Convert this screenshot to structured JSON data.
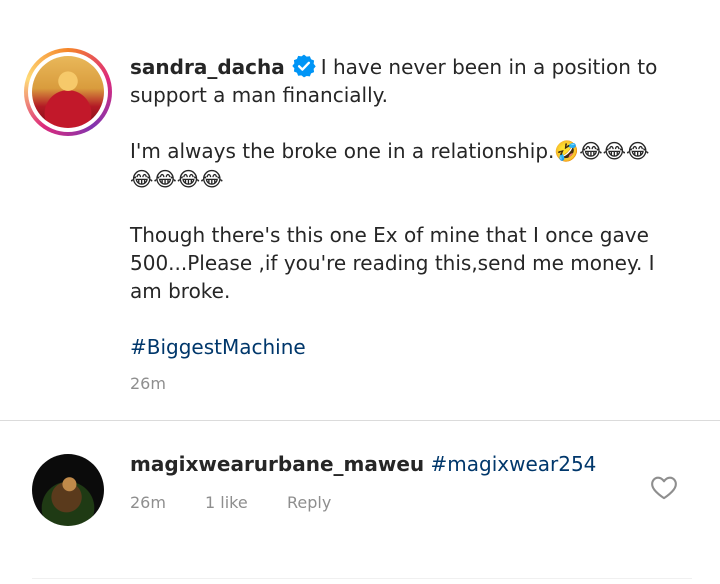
{
  "post": {
    "username": "sandra_dacha",
    "caption_line1": "I have never been in a position to support a man financially.",
    "caption_line2": "I'm always the broke one in a relationship.",
    "caption_emojis": "🤣😂😂😂😂😂😂😂",
    "caption_line3": "Though there's this one Ex of mine that I once gave 500...Please ,if you're reading this,send me money. I am broke.",
    "hashtag": "#BiggestMachine",
    "time": "26m"
  },
  "comment": {
    "username": "magixwearurbane_maweu",
    "hashtag": "#magixwear254",
    "time": "26m",
    "likes": "1 like",
    "reply_label": "Reply"
  },
  "icons": {
    "verified": "verified-badge-icon",
    "like": "heart-outline-icon"
  },
  "colors": {
    "hashtag": "#00376b",
    "verified": "#0095f6",
    "muted": "#8e8e8e"
  }
}
